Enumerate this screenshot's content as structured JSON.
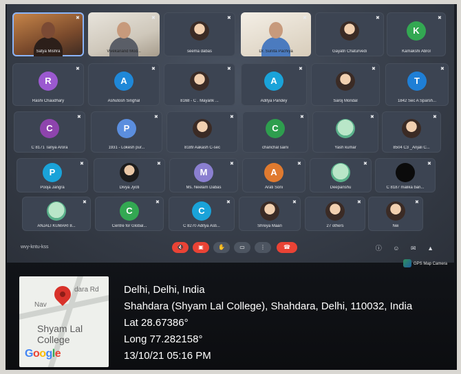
{
  "meeting": {
    "code": "wvy-kntu-kss",
    "participants_row1": [
      {
        "name": "Satya Mishra",
        "kind": "video-a"
      },
      {
        "name": "Vivekanand Mod...",
        "kind": "video-b"
      },
      {
        "name": "seema dabas",
        "kind": "photo",
        "color": "#c94b7a"
      },
      {
        "name": "Dr. Sunita Pachiya",
        "kind": "video-c"
      },
      {
        "name": "Gayatri Chaturvedi",
        "kind": "photo",
        "color": "#a33"
      },
      {
        "name": "Kamakshi Abrol",
        "initial": "K",
        "color": "#33a852"
      }
    ],
    "participants_row2": [
      {
        "name": "Rashi Chaudhary",
        "initial": "R",
        "color": "#9b59d0"
      },
      {
        "name": "Ashutosh Singhal",
        "initial": "A",
        "color": "#1f88d8"
      },
      {
        "name": "8168 - C . Mayank ...",
        "kind": "photo",
        "color": "#775"
      },
      {
        "name": "Aditya Pandey",
        "initial": "A",
        "color": "#1aa3d9"
      },
      {
        "name": "Saroj Mondal",
        "kind": "photo",
        "color": "#886"
      },
      {
        "name": "1842 Sec A Sparsh...",
        "initial": "T",
        "color": "#1f7fd6"
      }
    ],
    "participants_row3": [
      {
        "name": "C 8171 Tanya Arora",
        "initial": "C",
        "color": "#8e44ad"
      },
      {
        "name": "1931 - Lokesh pur...",
        "initial": "P",
        "color": "#5b8ede"
      },
      {
        "name": "8189 Aakash C-sec",
        "kind": "photo",
        "color": "#667"
      },
      {
        "name": "chanchal saini",
        "initial": "C",
        "color": "#2e9e4e"
      },
      {
        "name": "Yash kumar",
        "kind": "emoji",
        "color": "#5a9"
      },
      {
        "name": "8504 C3 _Anjali C...",
        "kind": "photo",
        "color": "#6a8"
      }
    ],
    "participants_row4": [
      {
        "name": "Pooja Jangra",
        "initial": "P",
        "color": "#1aa3d9"
      },
      {
        "name": "Divya Jyoti",
        "kind": "photo2",
        "color": "#444"
      },
      {
        "name": "Ms. Neelam Dabas",
        "initial": "M",
        "color": "#8a7fd0"
      },
      {
        "name": "Arati Soni",
        "initial": "A",
        "color": "#e07a2f"
      },
      {
        "name": "Deepanshu",
        "kind": "emoji",
        "color": "#5a9"
      },
      {
        "name": "C 8187 malika ban...",
        "kind": "dark",
        "color": "#000"
      }
    ],
    "participants_row5": [
      {
        "name": "ANJALI KUMARI 8...",
        "kind": "emoji",
        "color": "#cc3"
      },
      {
        "name": "Centre for Global...",
        "initial": "C",
        "color": "#33a852"
      },
      {
        "name": "C 8270 Aditya Asti...",
        "initial": "C",
        "color": "#1aa3d9"
      },
      {
        "name": "Shreya Maan",
        "kind": "photo",
        "color": "#667"
      },
      {
        "name": "27 others",
        "kind": "photo",
        "color": "#a98"
      },
      {
        "name": "Nei",
        "kind": "photo",
        "color": "#bbb"
      }
    ],
    "controls": [
      "mic-off",
      "cam-off",
      "hand",
      "present",
      "more",
      "hangup"
    ]
  },
  "gps": {
    "badge": "GPS Map Camera",
    "map_roads": [
      "Nav",
      "dara Rd"
    ],
    "map_poi": "Shyam Lal College",
    "map_brand": "Google",
    "city_line": "Delhi, Delhi, India",
    "address": "Shahdara (Shyam Lal College), Shahdara, Delhi, 110032, India",
    "lat": "Lat 28.67386°",
    "long": "Long 77.282158°",
    "datetime": "13/10/21 05:16 PM"
  }
}
